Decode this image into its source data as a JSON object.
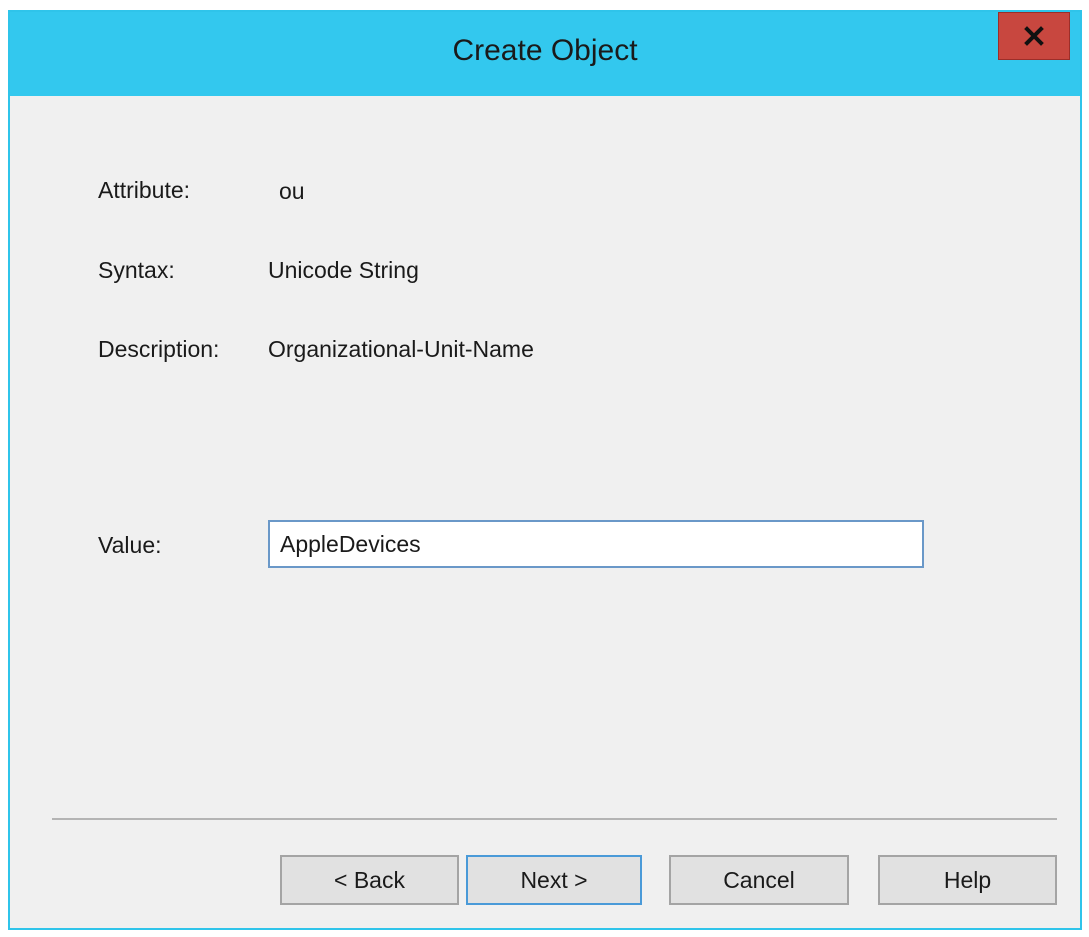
{
  "window": {
    "title": "Create Object",
    "close_label": "x"
  },
  "fields": {
    "attribute_label": "Attribute:",
    "attribute_value": "ou",
    "syntax_label": "Syntax:",
    "syntax_value": "Unicode String",
    "description_label": "Description:",
    "description_value": "Organizational-Unit-Name",
    "value_label": "Value:",
    "value_input": "AppleDevices"
  },
  "buttons": {
    "back": "< Back",
    "next": "Next >",
    "cancel": "Cancel",
    "help": "Help"
  },
  "colors": {
    "titlebar": "#33c8ee",
    "close_button": "#c8473f",
    "dialog_background": "#f0f0f0"
  },
  "icons": {
    "close": "close-icon"
  }
}
